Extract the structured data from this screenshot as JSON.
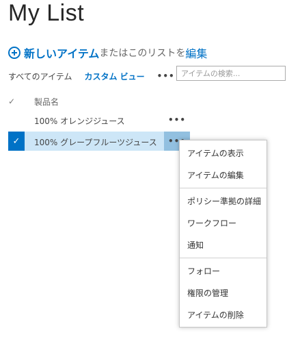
{
  "page": {
    "title": "My List"
  },
  "toolbar": {
    "new_item": "新しいアイテム",
    "or_text": "またはこのリストを",
    "edit": "編集"
  },
  "views": {
    "all_items": "すべてのアイテム",
    "custom_view": "カスタム ビュー",
    "more": "•••"
  },
  "search": {
    "placeholder": "アイテムの検索..."
  },
  "list": {
    "check_all_glyph": "✓",
    "column_title": "製品名",
    "rows": [
      {
        "title": "100% オレンジジュース",
        "selected": false
      },
      {
        "title": "100% グレープフルーツジュース",
        "selected": true
      }
    ],
    "row_ellipsis": "•••",
    "selected_check": "✓"
  },
  "context_menu": {
    "items": [
      "アイテムの表示",
      "アイテムの編集",
      "ポリシー準拠の詳細",
      "ワークフロー",
      "通知",
      "フォロー",
      "権限の管理",
      "アイテムの削除"
    ]
  },
  "colors": {
    "accent": "#0072c6",
    "selected_row": "#cde6f7",
    "selected_ellipsis": "#92c0e0"
  }
}
